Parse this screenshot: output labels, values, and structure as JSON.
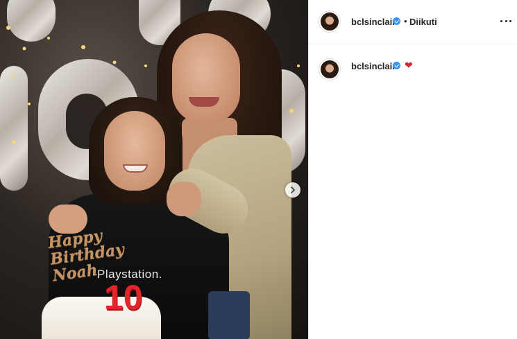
{
  "post": {
    "image_alt_text": "",
    "next_icon": "chevron-right-icon",
    "shirt_print": "Playstation.",
    "cake_topper": "Happy Birthday Noah",
    "candle_number": "10"
  },
  "header": {
    "username": "bclsinclair",
    "separator": "•",
    "follow_status": "Diikuti",
    "verified_icon": "verified-badge-icon",
    "more_icon": "more-options-icon"
  },
  "comment": {
    "username": "bclsinclair",
    "verified_icon": "verified-badge-icon",
    "text": "❤"
  },
  "colors": {
    "verified_blue": "#3897f0",
    "heart_red": "#d4202a",
    "text_primary": "#262626",
    "divider": "#efefef"
  }
}
